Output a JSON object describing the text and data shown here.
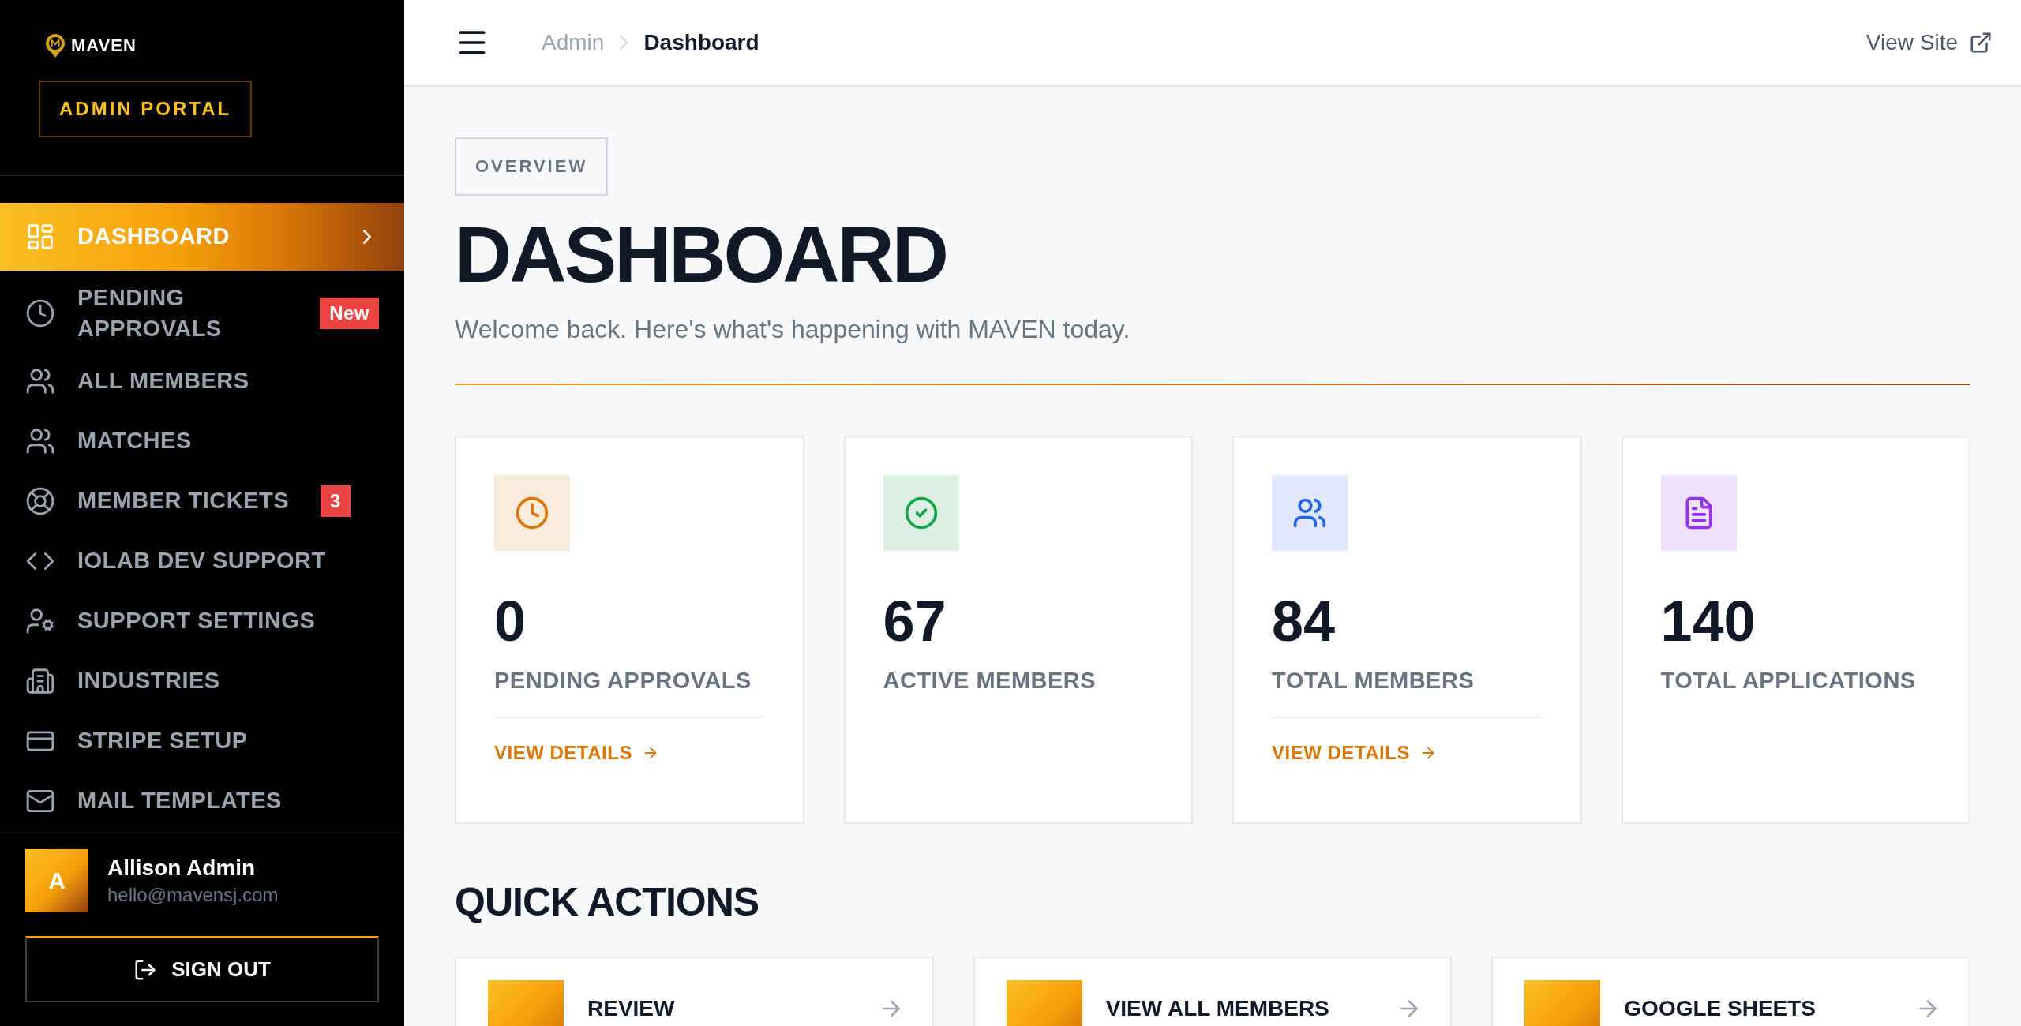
{
  "sidebar": {
    "logo": "MAVEN",
    "portal_label": "ADMIN PORTAL",
    "items": [
      {
        "label": "DASHBOARD",
        "selected": true
      },
      {
        "label": "PENDING APPROVALS",
        "selected": false,
        "badge": "New"
      },
      {
        "label": "ALL MEMBERS",
        "selected": false
      },
      {
        "label": "MATCHES",
        "selected": false
      },
      {
        "label": "MEMBER TICKETS",
        "selected": false,
        "badge": "3"
      },
      {
        "label": "IOLAB DEV SUPPORT",
        "selected": false
      },
      {
        "label": "SUPPORT SETTINGS",
        "selected": false
      },
      {
        "label": "INDUSTRIES",
        "selected": false
      },
      {
        "label": "STRIPE SETUP",
        "selected": false
      },
      {
        "label": "MAIL TEMPLATES",
        "selected": false
      }
    ],
    "user": {
      "initial": "A",
      "name": "Allison Admin",
      "email": "hello@mavensj.com"
    },
    "sign_out": "SIGN OUT"
  },
  "topbar": {
    "breadcrumb": [
      "Admin",
      "Dashboard"
    ],
    "view_site": "View Site"
  },
  "header": {
    "eyebrow": "OVERVIEW",
    "title": "DASHBOARD",
    "subtitle": "Welcome back. Here's what's happening with MAVEN today."
  },
  "stats": [
    {
      "value": "0",
      "label": "PENDING APPROVALS",
      "color": "#d97706",
      "link": "VIEW DETAILS"
    },
    {
      "value": "67",
      "label": "ACTIVE MEMBERS",
      "color": "#16a34a"
    },
    {
      "value": "84",
      "label": "TOTAL MEMBERS",
      "color": "#2563eb",
      "link": "VIEW DETAILS"
    },
    {
      "value": "140",
      "label": "TOTAL APPLICATIONS",
      "color": "#9333ea"
    }
  ],
  "quick_actions": {
    "title": "QUICK ACTIONS",
    "items": [
      "REVIEW",
      "VIEW ALL MEMBERS",
      "GOOGLE SHEETS"
    ]
  }
}
